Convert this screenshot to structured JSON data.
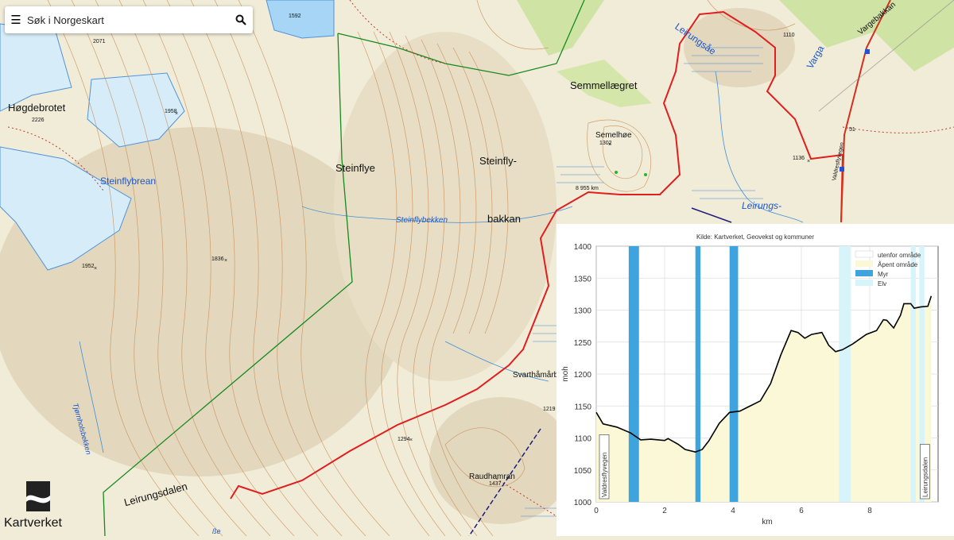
{
  "search": {
    "placeholder": "Søk i Norgeskart"
  },
  "brand": {
    "name": "Kartverket"
  },
  "map_labels": {
    "hogdebrotet": "Høgdebrotet",
    "steinflybrean": "Steinflybrean",
    "steinflye": "Steinflye",
    "steinfly": "Steinfly-",
    "bakkan": "bakkan",
    "steinflybekken": "Steinflybekken",
    "semmellaegret": "Semmellægret",
    "semelhoe": "Semelhøe",
    "leirungsae": "Leirungsåe",
    "leirungs": "Leirungs-",
    "varga": "Varga",
    "vargebakkan": "Vargebakkan",
    "valdresflyvegen": "Valdresflyvegen",
    "svarthamarb": "Svarthåmårb",
    "raudhamran": "Raudhamran",
    "leirungsdalen": "Leirungsdalen",
    "tjornholsbekken": "Tjørnholsbekken",
    "route_distance": "8 955 km",
    "be": "ße"
  },
  "spot_heights": [
    "1592",
    "2071",
    "2226",
    "1958",
    "1952",
    "1836",
    "1302",
    "1110",
    "1136",
    "51",
    "1219",
    "1294",
    "1437"
  ],
  "colors": {
    "terrain": "#f1ecd8",
    "contour": "#c98b52",
    "water": "#1b56c9",
    "route": "#e11e1e",
    "boundary": "#148a1e",
    "glacier": "#d6ecf9"
  },
  "chart_data": {
    "type": "area",
    "title": "Kilde: Kartverket, Geovekst og kommuner",
    "xlabel": "km",
    "ylabel": "moh",
    "xlim": [
      0,
      10
    ],
    "ylim": [
      1000,
      1400
    ],
    "xticks": [
      0,
      2,
      4,
      6,
      8
    ],
    "yticks": [
      1000,
      1050,
      1100,
      1150,
      1200,
      1250,
      1300,
      1350,
      1400
    ],
    "grid": true,
    "legend_position": "top-right",
    "legend": [
      "utenfor område",
      "Åpent område",
      "Myr",
      "Elv"
    ],
    "series": [
      {
        "x": [
          0,
          0.2,
          0.6,
          1.0,
          1.3,
          1.6,
          2.0,
          2.1,
          2.4,
          2.6,
          2.9,
          3.1,
          3.3,
          3.6,
          3.9,
          4.2,
          4.5,
          4.8,
          5.1,
          5.4,
          5.7,
          5.9,
          6.1,
          6.3,
          6.6,
          6.8,
          7.0,
          7.2,
          7.5,
          7.9,
          8.2,
          8.4,
          8.5,
          8.7,
          8.9,
          9.0,
          9.2,
          9.3,
          9.5,
          9.7,
          9.8
        ],
        "y": [
          1140,
          1122,
          1117,
          1108,
          1097,
          1098,
          1096,
          1099,
          1090,
          1082,
          1078,
          1082,
          1096,
          1123,
          1140,
          1142,
          1150,
          1158,
          1185,
          1230,
          1268,
          1265,
          1256,
          1262,
          1265,
          1245,
          1235,
          1238,
          1247,
          1262,
          1268,
          1285,
          1284,
          1272,
          1292,
          1310,
          1310,
          1303,
          1305,
          1306,
          1322
        ]
      }
    ],
    "bands": [
      {
        "type": "Myr",
        "x0": 0.95,
        "x1": 1.25
      },
      {
        "type": "Myr",
        "x0": 2.9,
        "x1": 3.05
      },
      {
        "type": "Myr",
        "x0": 3.9,
        "x1": 4.15
      },
      {
        "type": "Elv",
        "x0": 7.1,
        "x1": 7.45
      },
      {
        "type": "Elv",
        "x0": 9.2,
        "x1": 9.35
      },
      {
        "type": "Elv",
        "x0": 9.45,
        "x1": 9.6
      }
    ],
    "annotations": [
      "Valdresflyvegen",
      "Leirungsdalen"
    ]
  }
}
